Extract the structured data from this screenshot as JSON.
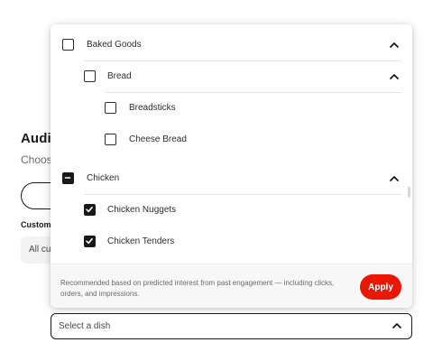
{
  "background": {
    "section_title": "Audi",
    "section_subtitle": "Choos",
    "field_label": "Custom",
    "select_value": "All cu"
  },
  "dish_tree": {
    "items": [
      {
        "label": "Baked Goods",
        "state": "unchecked",
        "expanded": true,
        "level": 0
      },
      {
        "label": "Bread",
        "state": "unchecked",
        "expanded": true,
        "level": 1
      },
      {
        "label": "Breadsticks",
        "state": "unchecked",
        "level": 2
      },
      {
        "label": "Cheese Bread",
        "state": "unchecked",
        "level": 2
      },
      {
        "label": "Chicken",
        "state": "indeterminate",
        "expanded": true,
        "level": 0
      },
      {
        "label": "Chicken Nuggets",
        "state": "checked",
        "level": 1
      },
      {
        "label": "Chicken Tenders",
        "state": "checked",
        "level": 1
      }
    ]
  },
  "footer": {
    "note": "Recommended based on predicted interest from past engagement — including clicks, orders, and impressions.",
    "apply_label": "Apply"
  },
  "dish_select": {
    "placeholder": "Select a dish"
  },
  "colors": {
    "accent": "#eb1700",
    "text": "#191919",
    "muted": "#6b6b6b"
  },
  "icons": {
    "expand": "chevron-up-icon",
    "checked": "check-icon",
    "indeterminate": "minus-icon"
  }
}
